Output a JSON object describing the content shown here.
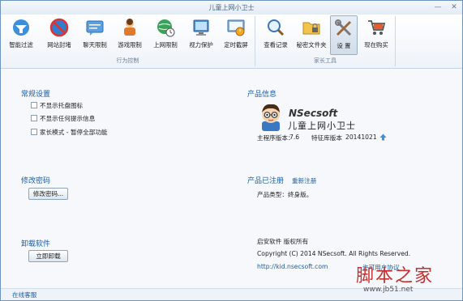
{
  "window": {
    "title": "儿童上网小卫士",
    "minimize_glyph": "—",
    "close_glyph": "✕"
  },
  "toolbar": {
    "tools": [
      {
        "label": "智能过滤",
        "icon": "smart-filter-icon"
      },
      {
        "label": "网站封堵",
        "icon": "website-block-icon"
      },
      {
        "label": "聊天限制",
        "icon": "chat-limit-icon"
      },
      {
        "label": "游戏限制",
        "icon": "game-limit-icon"
      },
      {
        "label": "上网限制",
        "icon": "internet-limit-icon"
      },
      {
        "label": "视力保护",
        "icon": "eye-protection-icon"
      },
      {
        "label": "定时截屏",
        "icon": "scheduled-screenshot-icon"
      },
      {
        "label": "查看记录",
        "icon": "view-records-icon"
      },
      {
        "label": "秘密文件夹",
        "icon": "secret-folder-icon"
      },
      {
        "label": "设 置",
        "icon": "settings-icon",
        "active": true
      },
      {
        "label": "现在购买",
        "icon": "buy-now-icon"
      }
    ],
    "groups": {
      "behavior_control": "行为控制",
      "parent_tools": "家长工具"
    }
  },
  "general": {
    "title": "常规设置",
    "options": [
      {
        "label": "不显示托盘图标",
        "checked": false
      },
      {
        "label": "不显示任何提示信息",
        "checked": false
      },
      {
        "label": "家长模式 - 暂停全部功能",
        "checked": false
      }
    ]
  },
  "password": {
    "title": "修改密码",
    "button": "修改密码..."
  },
  "uninstall": {
    "title": "卸载软件",
    "button": "立即卸载"
  },
  "product": {
    "title": "产品信息",
    "brand": "NSecsoft",
    "name": "儿童上网小卫士",
    "main_version_label": "主程序版本：",
    "main_version": "7.6",
    "db_version_label": "特征库版本",
    "db_version": "20141021"
  },
  "registration": {
    "title": "产品已注册",
    "re_register": "重新注册",
    "type_text": "产品类型：终身版。"
  },
  "copyright": {
    "line1": "启安软件 版权所有",
    "line2": "Copyright (C) 2014 NSecsoft. All Rights Reserved.",
    "url": "http://kid.nsecsoft.com",
    "agreement": "许可用户协议"
  },
  "statusbar": {
    "online_service": "在线客服"
  },
  "watermark": {
    "text": "脚本之家",
    "url": "www.jb51.net"
  },
  "colors": {
    "accent": "#1a5ca8",
    "window_border": "#6e93bd",
    "watermark": "#c72f2f"
  }
}
